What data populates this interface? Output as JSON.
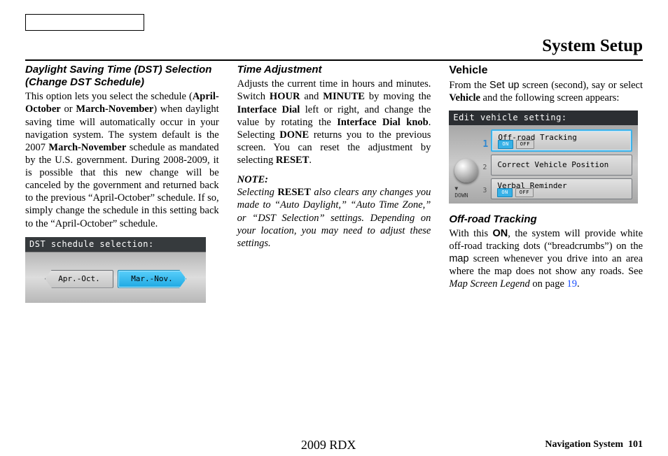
{
  "pageTitle": "System Setup",
  "col1": {
    "heading": "Daylight Saving Time (DST) Selection (Change DST Schedule)",
    "p1a": "This option lets you select the schedule (",
    "p1b": "April-October",
    "p1c": " or ",
    "p1d": "March-November",
    "p1e": ") when daylight saving time will automatically occur in your navigation system. The system default is the 2007 ",
    "p1f": "March-November",
    "p1g": " schedule as mandated by the U.S. government. During 2008-2009, it is possible that this new change will be canceled by the government and returned back to the previous “April-October” schedule. If so, simply change the schedule in this setting back to the “April-October” schedule.",
    "fig": {
      "title": "DST schedule selection:",
      "opt1": "Apr.-Oct.",
      "opt2": "Mar.-Nov."
    }
  },
  "col2": {
    "heading1": "Time Adjustment",
    "p1a": "Adjusts the current time in hours and minutes. Switch ",
    "p1b": "HOUR",
    "p1c": " and ",
    "p1d": "MINUTE",
    "p1e": " by moving the ",
    "p1f": "Interface Dial",
    "p1g": " left or right, and change the value by rotating the ",
    "p1h": "Interface Dial knob",
    "p1i": ". Selecting ",
    "p1j": "DONE",
    "p1k": " returns you to the previous screen. You can reset the adjustment by selecting ",
    "p1l": "RESET",
    "p1m": ".",
    "noteLabel": "NOTE:",
    "n1": "Selecting ",
    "n2": "RESET",
    "n3": " also clears any changes you made to “Auto Daylight,” “Auto Time Zone,” or “DST Selection” settings. Depending on your location, you may need to adjust these settings."
  },
  "col3": {
    "heading1": "Vehicle",
    "p1a": "From the ",
    "p1b": "Set up",
    "p1c": " screen (second), say or select ",
    "p1d": "Vehicle",
    "p1e": " and the following screen appears:",
    "fig": {
      "title": "Edit vehicle setting:",
      "row1": "Off-road Tracking",
      "row2": "Correct Vehicle Position",
      "row3": "Verbal Reminder",
      "on": "ON",
      "off": "OFF",
      "down": "DOWN",
      "n1": "1",
      "n2": "2",
      "n3": "3"
    },
    "heading2": "Off-road Tracking",
    "p2a": "With this ",
    "p2b": "ON",
    "p2c": ", the system will provide white off-road tracking dots (“breadcrumbs”) on the ",
    "p2d": "map",
    "p2e": " screen whenever you drive into an area where the map does not show any roads. See ",
    "p2f": "Map Screen Legend",
    "p2g": " on page ",
    "p2h": "19",
    "p2i": "."
  },
  "footer": {
    "model": "2009  RDX",
    "label": "Navigation System",
    "page": "101"
  }
}
